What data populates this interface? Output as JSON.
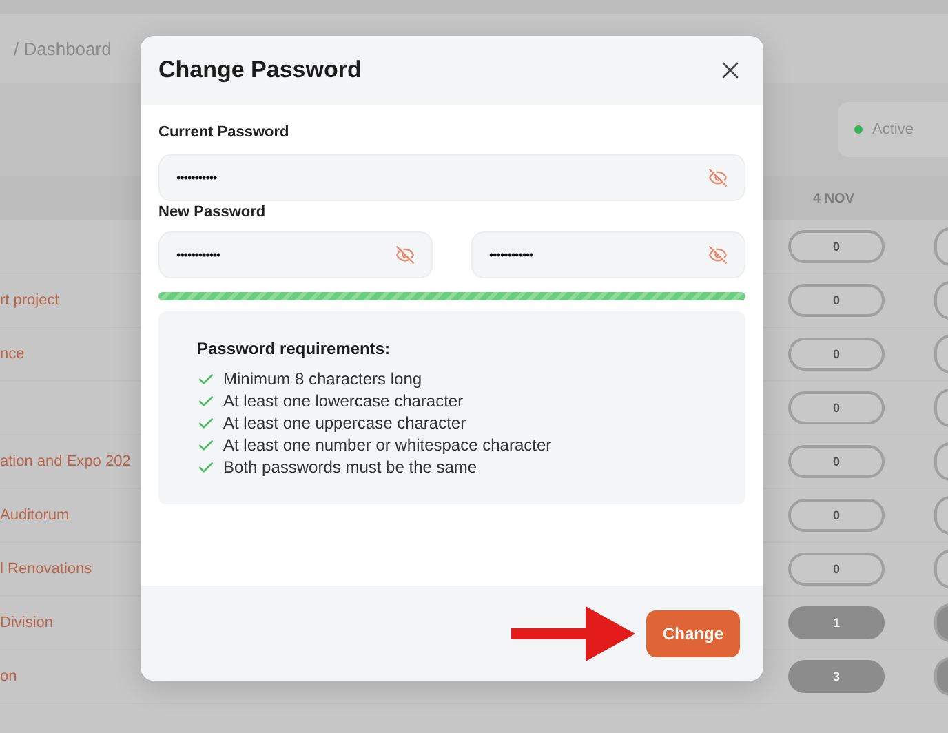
{
  "background": {
    "breadcrumb": "/ Dashboard",
    "status": {
      "label": "Active",
      "color": "#3cb55a"
    },
    "date_header": "4 NOV",
    "rows": [
      {
        "name": "",
        "count": "0",
        "kind": "light"
      },
      {
        "name": "rt project",
        "count": "0",
        "kind": "light"
      },
      {
        "name": "nce",
        "count": "0",
        "kind": "light"
      },
      {
        "name": "",
        "count": "0",
        "kind": "light"
      },
      {
        "name": "ation and Expo 202",
        "count": "0",
        "kind": "light"
      },
      {
        "name": "Auditorum",
        "count": "0",
        "kind": "light"
      },
      {
        "name": "l Renovations",
        "count": "0",
        "kind": "light"
      },
      {
        "name": "Division",
        "count": "1",
        "kind": "dark"
      },
      {
        "name": "on",
        "count": "3",
        "kind": "dark"
      }
    ]
  },
  "dialog": {
    "title": "Change Password",
    "current_password": {
      "label": "Current Password",
      "value": "•••••••••••",
      "visible": false
    },
    "new_password": {
      "label": "New Password",
      "fields": [
        {
          "value": "••••••••••••",
          "visible": false
        },
        {
          "value": "••••••••••••",
          "visible": false
        }
      ]
    },
    "strength": {
      "level": 1
    },
    "requirements": {
      "title": "Password requirements:",
      "items": [
        {
          "text": "Minimum 8 characters long",
          "met": true
        },
        {
          "text": "At least one lowercase character",
          "met": true
        },
        {
          "text": "At least one uppercase character",
          "met": true
        },
        {
          "text": "At least one number or whitespace character",
          "met": true
        },
        {
          "text": "Both passwords must be the same",
          "met": true
        }
      ]
    },
    "buttons": [
      {
        "label": "Change",
        "kind": "primary"
      }
    ],
    "pointer_arrow": true
  }
}
